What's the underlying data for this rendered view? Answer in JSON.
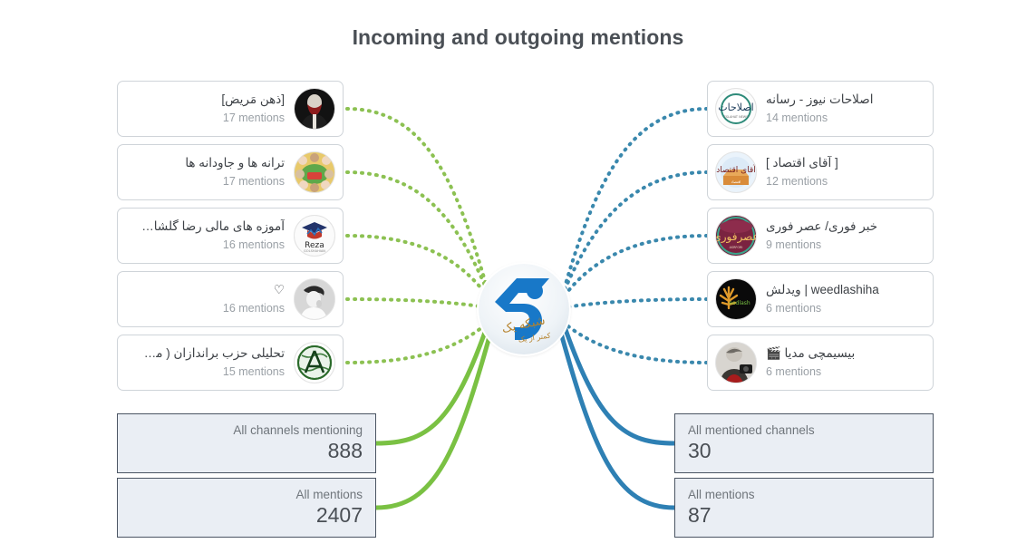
{
  "page": {
    "title": "Incoming and outgoing mentions",
    "mentions_word": "mentions"
  },
  "hub": {
    "name": "hub-channel-logo",
    "label_fa": "شبکه یک",
    "sublabel_fa": "کمتر از یک",
    "accent_blue": "#1878c8",
    "accent_light": "#e6f0f8"
  },
  "colors": {
    "green": "#7ac143",
    "green_dot": "#8cc152",
    "blue": "#2e80b4",
    "blue_dot": "#3a88ad",
    "card_border": "#cfd4d9",
    "summary_bg": "#eaeef4",
    "summary_border": "#4b5563",
    "title_text": "#4a4f55",
    "muted_text": "#9aa0a6"
  },
  "incoming": {
    "side": "left",
    "channels": [
      {
        "title": "[ذهن مَریض]",
        "mentions": "17",
        "mentions_text": "17 mentions",
        "avatar": "joker-avatar"
      },
      {
        "title": "ترانه ها و جاودانه ها",
        "mentions": "17",
        "mentions_text": "17 mentions",
        "avatar": "collage-avatar"
      },
      {
        "title": "آموزه های مالی رضا گلشاهیان",
        "mentions": "16",
        "mentions_text": "16 mentions",
        "avatar": "reza-graduation-avatar"
      },
      {
        "title": "♡",
        "mentions": "16",
        "mentions_text": "16 mentions",
        "avatar": "grayscale-portrait-avatar"
      },
      {
        "title": "تحلیلی حزب براندازان ( موتا )...",
        "mentions": "15",
        "mentions_text": "15 mentions",
        "avatar": "anarchy-globe-avatar"
      }
    ],
    "summaries": [
      {
        "label": "All channels mentioning",
        "value": "888"
      },
      {
        "label": "All mentions",
        "value": "2407"
      }
    ]
  },
  "outgoing": {
    "side": "right",
    "channels": [
      {
        "title": "اصلاحات نیوز - رسانه",
        "mentions": "14",
        "mentions_text": "14 mentions",
        "avatar": "eslahat-news-avatar"
      },
      {
        "title": "[ آقای اقتصاد ]",
        "mentions": "12",
        "mentions_text": "12 mentions",
        "avatar": "aghaye-eghtesad-avatar"
      },
      {
        "title": "خبر فوری/ عصر فوری",
        "mentions": "9",
        "mentions_text": "9 mentions",
        "avatar": "asr-fori-avatar"
      },
      {
        "title": "weedlashiha | ویدلش",
        "mentions": "6",
        "mentions_text": "6 mentions",
        "avatar": "weedlash-leaf-avatar"
      },
      {
        "title": "بیسیمچی مدیا 🎬",
        "mentions": "6",
        "mentions_text": "6 mentions",
        "avatar": "bisimchi-media-avatar"
      }
    ],
    "summaries": [
      {
        "label": "All mentioned channels",
        "value": "30"
      },
      {
        "label": "All mentions",
        "value": "87"
      }
    ]
  }
}
